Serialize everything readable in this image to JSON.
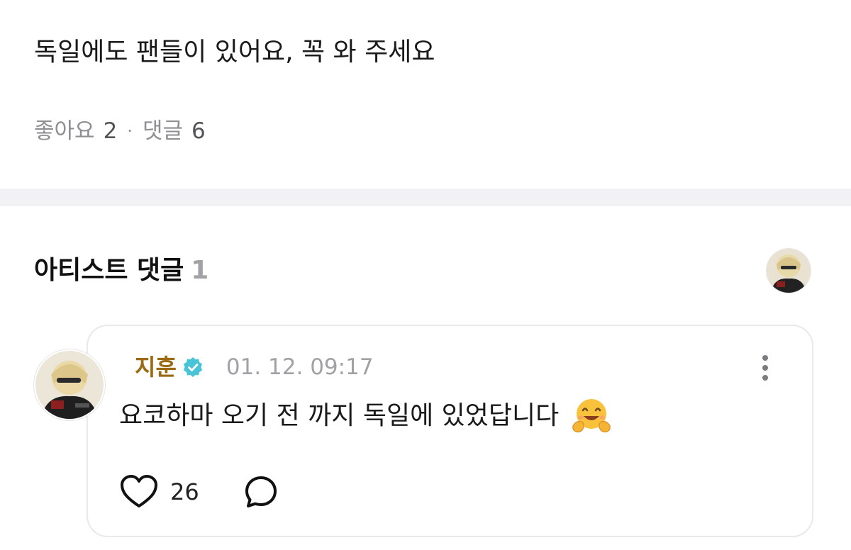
{
  "post": {
    "text": "독일에도 팬들이 있어요, 꼭 와 주세요",
    "likes_label": "좋아요",
    "likes_count": "2",
    "separator": "·",
    "comments_label": "댓글",
    "comments_count": "6"
  },
  "artist_comments": {
    "title": "아티스트 댓글",
    "count": "1"
  },
  "comment": {
    "author": "지훈",
    "verified_icon": "verified-badge-icon",
    "timestamp": "01. 12. 09:17",
    "text": "요코하마 오기 전 까지 독일에 있었답니다",
    "emoji": "hugging-face-emoji",
    "like_count": "26",
    "more_icon": "kebab-menu-icon",
    "like_icon": "heart-outline-icon",
    "reply_icon": "speech-bubble-icon"
  },
  "colors": {
    "author": "#9a6b12",
    "verified": "#49c3d6",
    "muted": "#8e8e93",
    "divider": "#f2f2f4",
    "card_border": "#e9e9ed"
  }
}
